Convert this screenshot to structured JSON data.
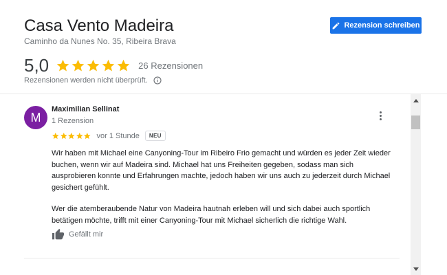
{
  "place": {
    "title": "Casa Vento Madeira",
    "address": "Caminho da Nunes No. 35, Ribeira Brava"
  },
  "write_review_button": {
    "label": "Rezension schreiben",
    "icon": "pencil-icon",
    "color": "#1a73e8"
  },
  "rating": {
    "value": "5,0",
    "stars": 5,
    "count_label": "26 Rezensionen",
    "star_color": "#fbbc04"
  },
  "notice": {
    "text": "Rezensionen werden nicht überprüft.",
    "icon": "info-icon"
  },
  "review": {
    "avatar_letter": "M",
    "avatar_color": "#7b1fa2",
    "name": "Maximilian Sellinat",
    "review_count": "1 Rezension",
    "stars": 5,
    "time": "vor 1 Stunde",
    "badge": "NEU",
    "paragraph_1": "Wir haben mit Michael eine Canyoning-Tour im Ribeiro Frio gemacht und würden es jeder Zeit wieder buchen, wenn wir auf Madeira sind. Michael hat uns Freiheiten gegeben, sodass man sich ausprobieren konnte und Erfahrungen machte, jedoch haben wir uns auch zu jederzeit durch Michael gesichert gefühlt.",
    "paragraph_2": "Wer die atemberaubende Natur von Madeira hautnah erleben will und sich dabei auch sportlich betätigen möchte, trifft mit einer Canyoning-Tour mit Michael sicherlich die richtige Wahl.",
    "like_label": "Gefällt mir"
  }
}
